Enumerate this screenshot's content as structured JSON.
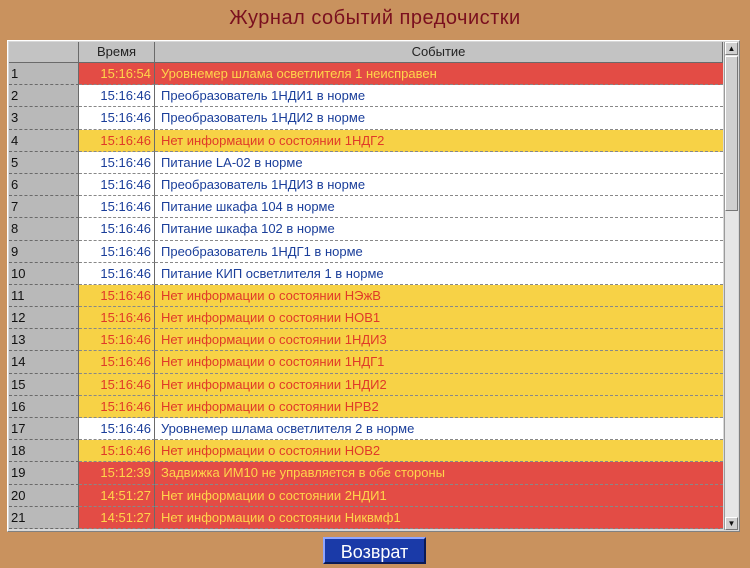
{
  "title": "Журнал событий предочистки",
  "table": {
    "headers": {
      "num": "",
      "time": "Время",
      "event": "Событие"
    },
    "rows": [
      {
        "num": "1",
        "time": "15:16:54",
        "event": "Уровнемер шлама осветлителя 1 неисправен",
        "status": "alarm"
      },
      {
        "num": "2",
        "time": "15:16:46",
        "event": "Преобразователь 1НДИ1 в норме",
        "status": "ok"
      },
      {
        "num": "3",
        "time": "15:16:46",
        "event": "Преобразователь 1НДИ2 в норме",
        "status": "ok"
      },
      {
        "num": "4",
        "time": "15:16:46",
        "event": "Нет информации о состоянии 1НДГ2",
        "status": "warn"
      },
      {
        "num": "5",
        "time": "15:16:46",
        "event": "Питание LA-02 в норме",
        "status": "ok"
      },
      {
        "num": "6",
        "time": "15:16:46",
        "event": "Преобразователь 1НДИ3 в норме",
        "status": "ok"
      },
      {
        "num": "7",
        "time": "15:16:46",
        "event": "Питание шкафа 104 в норме",
        "status": "ok"
      },
      {
        "num": "8",
        "time": "15:16:46",
        "event": "Питание шкафа 102 в норме",
        "status": "ok"
      },
      {
        "num": "9",
        "time": "15:16:46",
        "event": "Преобразователь 1НДГ1 в норме",
        "status": "ok"
      },
      {
        "num": "10",
        "time": "15:16:46",
        "event": "Питание КИП осветлителя 1 в норме",
        "status": "ok"
      },
      {
        "num": "11",
        "time": "15:16:46",
        "event": "Нет информации о состоянии НЭжВ",
        "status": "warn"
      },
      {
        "num": "12",
        "time": "15:16:46",
        "event": "Нет информации о состоянии НОВ1",
        "status": "warn"
      },
      {
        "num": "13",
        "time": "15:16:46",
        "event": "Нет информации о состоянии 1НДИ3",
        "status": "warn"
      },
      {
        "num": "14",
        "time": "15:16:46",
        "event": "Нет информации о состоянии 1НДГ1",
        "status": "warn"
      },
      {
        "num": "15",
        "time": "15:16:46",
        "event": "Нет информации о состоянии 1НДИ2",
        "status": "warn"
      },
      {
        "num": "16",
        "time": "15:16:46",
        "event": "Нет информации о состоянии НРВ2",
        "status": "warn"
      },
      {
        "num": "17",
        "time": "15:16:46",
        "event": "Уровнемер шлама осветлителя 2 в норме",
        "status": "ok"
      },
      {
        "num": "18",
        "time": "15:16:46",
        "event": "Нет информации о состоянии НОВ2",
        "status": "warn"
      },
      {
        "num": "19",
        "time": "15:12:39",
        "event": "Задвижка ИМ10 не управляется в обе стороны",
        "status": "alarm"
      },
      {
        "num": "20",
        "time": "14:51:27",
        "event": "Нет информации о состоянии 2НДИ1",
        "status": "alarm"
      },
      {
        "num": "21",
        "time": "14:51:27",
        "event": "Нет информации о состоянии Никвмф1",
        "status": "alarm"
      }
    ]
  },
  "back_button": {
    "label": "Возврат"
  },
  "colors": {
    "background": "#c9925e",
    "title": "#7a0f1e",
    "ok_row": "#ffffff",
    "warn_row": "#f7d246",
    "alarm_row": "#e34c45",
    "button": "#1a3aa8"
  }
}
